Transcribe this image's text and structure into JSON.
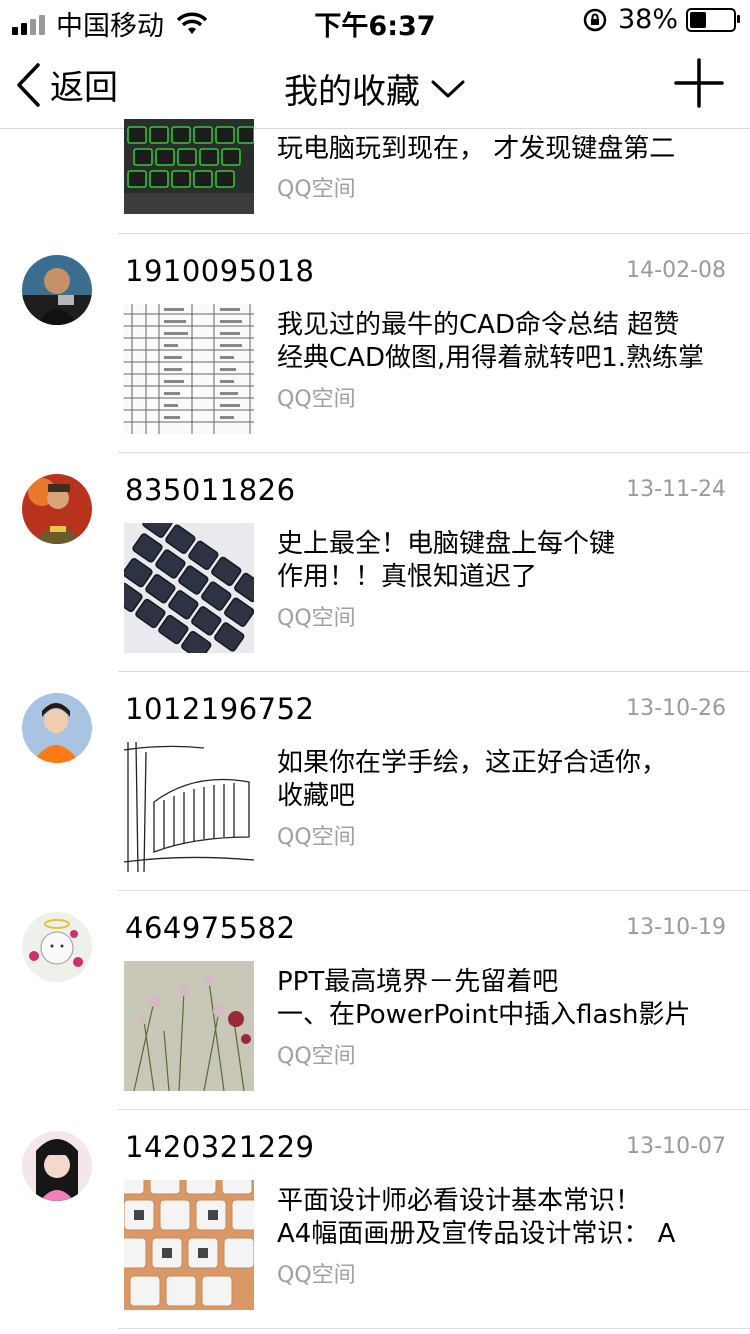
{
  "status_bar": {
    "carrier": "中国移动",
    "time": "下午6:37",
    "battery": "38%",
    "battery_level": 0.38
  },
  "nav": {
    "back_label": "返回",
    "title": "我的收藏"
  },
  "partial_item": {
    "text": "玩电脑玩到现在， 才发现键盘第二",
    "source": "QQ空间"
  },
  "items": [
    {
      "user": "1910095018",
      "date": "14-02-08",
      "line1": "我见过的最牛的CAD命令总结 超赞",
      "line2": "经典CAD做图,用得着就转吧1.熟练掌",
      "source": "QQ空间"
    },
    {
      "user": "835011826",
      "date": "13-11-24",
      "line1": "史上最全！电脑键盘上每个键",
      "line2": "作用！！真恨知道迟了",
      "source": "QQ空间"
    },
    {
      "user": "1012196752",
      "date": "13-10-26",
      "line1": "如果你在学手绘，这正好合适你，",
      "line2": "收藏吧",
      "source": "QQ空间"
    },
    {
      "user": "464975582",
      "date": "13-10-19",
      "line1": "PPT最高境界－先留着吧",
      "line2": "一、在PowerPoint中插入flash影片",
      "source": "QQ空间"
    },
    {
      "user": "1420321229",
      "date": "13-10-07",
      "line1": "平面设计师必看设计基本常识！",
      "line2": "A4幅面画册及宣传品设计常识：  A",
      "source": "QQ空间"
    }
  ]
}
